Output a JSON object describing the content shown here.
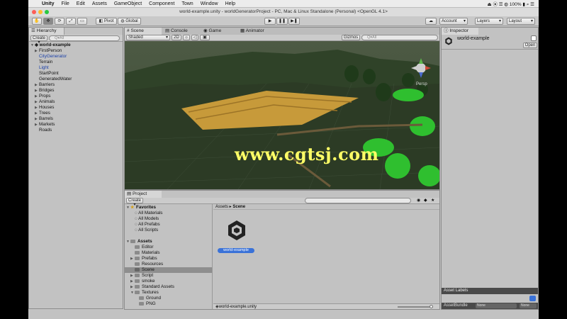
{
  "menubar": {
    "items": [
      "Unity",
      "File",
      "Edit",
      "Assets",
      "GameObject",
      "Component",
      "Town",
      "Window",
      "Help"
    ],
    "right_text": "⏏ ⦿ ☰ ◍ 100% ▮ ⌕ ☰"
  },
  "window_title": "world-example.unity - worldGeneratorProject - PC, Mac & Linux Standalone (Personal) <OpenGL 4.1>",
  "toolbar": {
    "pivot": "Pivot",
    "global": "Global",
    "account": "Account",
    "layers": "Layers",
    "layout": "Layout"
  },
  "hierarchy": {
    "tab": "Hierarchy",
    "create": "Create",
    "search_placeholder": "Q▾All",
    "scene": "world-example",
    "items": [
      "FirstPerson",
      "CityGenerator",
      "Terrain",
      "Light",
      "StartPoint",
      "GeneratedWater",
      "Barriers",
      "Bridges",
      "Props",
      "Animals",
      "Houses",
      "Trees",
      "Barrels",
      "Markets",
      "Roads"
    ]
  },
  "scene_tabs": {
    "scene": "Scene",
    "console": "Console",
    "game": "Game",
    "animator": "Animator"
  },
  "scene_toolbar": {
    "shaded": "Shaded",
    "mode2d": "2D",
    "gizmos": "Gizmos",
    "search": "Q▾All",
    "persp": "Persp"
  },
  "watermark": "www.cgtsj.com",
  "project": {
    "tab": "Project",
    "create": "Create",
    "breadcrumb_root": "Assets",
    "breadcrumb_current": "Scene",
    "favorites": {
      "label": "Favorites",
      "items": [
        "All Materials",
        "All Models",
        "All Prefabs",
        "All Scripts"
      ]
    },
    "assets": {
      "label": "Assets",
      "items": [
        "Editor",
        "Materials",
        "Prefabs",
        "Resources",
        "Scene",
        "Script",
        "smoke",
        "Standard Assets",
        "Textures",
        "Ground",
        "PNG"
      ]
    },
    "asset_name": "world-example",
    "status_file": "world-example.unity"
  },
  "inspector": {
    "tab": "Inspector",
    "object_name": "world-example",
    "open_button": "Open",
    "asset_labels": "Asset Labels",
    "asset_bundle": "AssetBundle",
    "bundle_none": "None",
    "bundle_none2": "None"
  }
}
